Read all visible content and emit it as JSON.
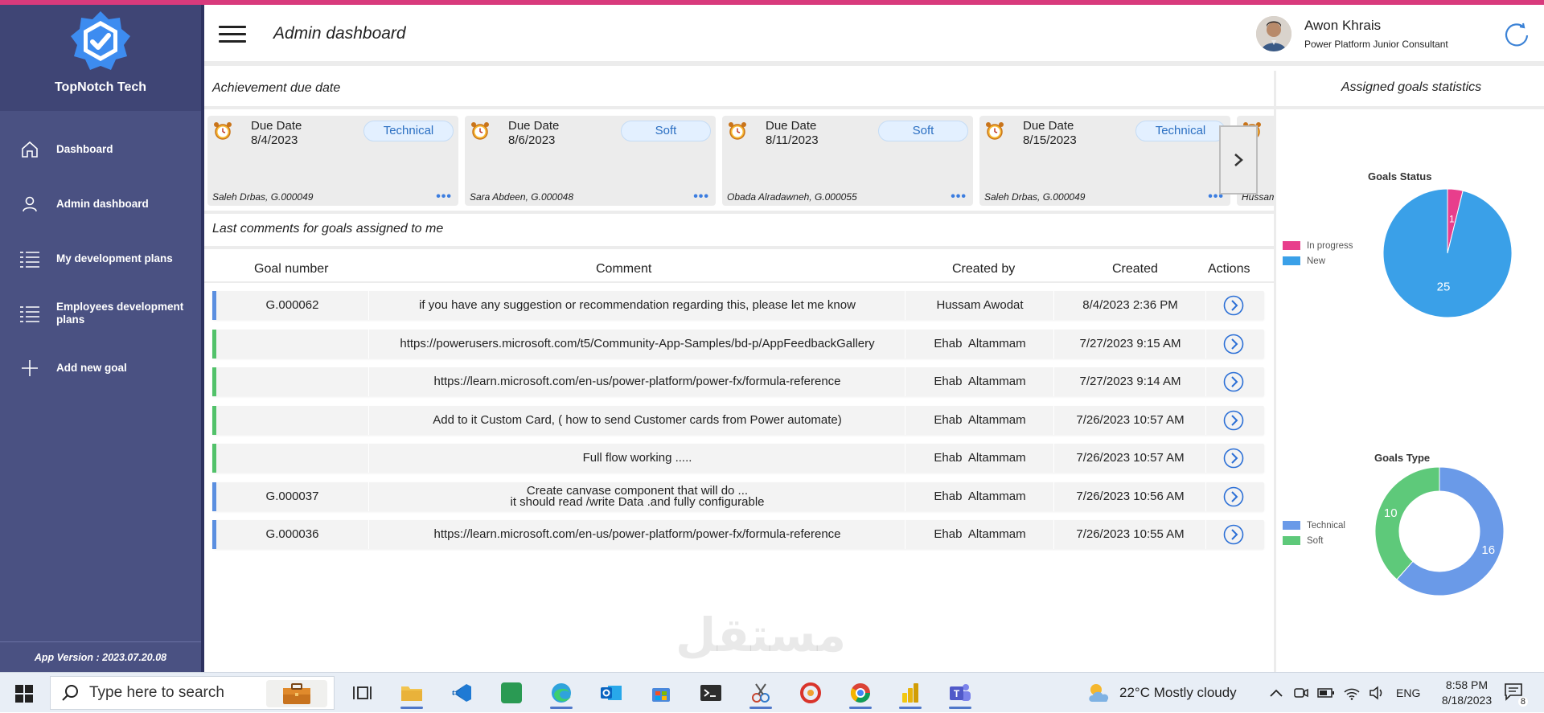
{
  "brand": {
    "name": "TopNotch Tech"
  },
  "sidebar": {
    "items": [
      {
        "label": "Dashboard",
        "icon": "home-icon"
      },
      {
        "label": "Admin dashboard",
        "icon": "person-icon"
      },
      {
        "label": "My development plans",
        "icon": "list-icon"
      },
      {
        "label": "Employees development plans",
        "icon": "list-icon"
      },
      {
        "label": "Add new goal",
        "icon": "plus-icon"
      }
    ],
    "version": "App Version : 2023.07.20.08"
  },
  "header": {
    "title": "Admin dashboard",
    "user_name": "Awon Khrais",
    "user_role": "Power Platform Junior Consultant"
  },
  "achievements": {
    "title": "Achievement due date",
    "cards": [
      {
        "due_label": "Due Date",
        "due_date": "8/4/2023",
        "type": "Technical",
        "who": "Saleh Drbas, G.000049"
      },
      {
        "due_label": "Due Date",
        "due_date": "8/6/2023",
        "type": "Soft",
        "who": "Sara Abdeen, G.000048"
      },
      {
        "due_label": "Due Date",
        "due_date": "8/11/2023",
        "type": "Soft",
        "who": "Obada Alradawneh, G.000055"
      },
      {
        "due_label": "Due Date",
        "due_date": "8/15/2023",
        "type": "Technical",
        "who": "Saleh Drbas, G.000049"
      },
      {
        "due_label": "",
        "due_date": "",
        "type": "",
        "who": "Hussam"
      }
    ]
  },
  "comments": {
    "title": "Last comments for goals assigned to me",
    "columns": {
      "goal": "Goal number",
      "comment": "Comment",
      "by": "Created by",
      "created": "Created",
      "actions": "Actions"
    },
    "rows": [
      {
        "goal": "G.000062",
        "comment": "if you have any suggestion or recommendation regarding this, please let me know",
        "by": "Hussam Awodat",
        "created": "8/4/2023 2:36 PM",
        "accent": "#5b8fe0"
      },
      {
        "goal": "",
        "comment": "https://powerusers.microsoft.com/t5/Community-App-Samples/bd-p/AppFeedbackGallery",
        "by": "Ehab  Altammam",
        "created": "7/27/2023 9:15 AM",
        "accent": "#52c26a"
      },
      {
        "goal": "",
        "comment": "https://learn.microsoft.com/en-us/power-platform/power-fx/formula-reference",
        "by": "Ehab  Altammam",
        "created": "7/27/2023 9:14 AM",
        "accent": "#52c26a"
      },
      {
        "goal": "",
        "comment": "Add to it Custom Card, ( how to send Customer cards from Power automate)",
        "by": "Ehab  Altammam",
        "created": "7/26/2023 10:57 AM",
        "accent": "#52c26a"
      },
      {
        "goal": "",
        "comment": "Full flow working .....",
        "by": "Ehab  Altammam",
        "created": "7/26/2023 10:57 AM",
        "accent": "#52c26a"
      },
      {
        "goal": "G.000037",
        "comment": "Create canvase component that will do ...\nit should read /write Data .and fully configurable",
        "by": "Ehab  Altammam",
        "created": "7/26/2023 10:56 AM",
        "accent": "#5b8fe0"
      },
      {
        "goal": "G.000036",
        "comment": "https://learn.microsoft.com/en-us/power-platform/power-fx/formula-reference",
        "by": "Ehab  Altammam",
        "created": "7/26/2023 10:55 AM",
        "accent": "#5b8fe0"
      }
    ]
  },
  "stats": {
    "title": "Assigned goals statistics"
  },
  "chart_data": [
    {
      "type": "pie",
      "title": "Goals Status",
      "categories": [
        "In progress",
        "New"
      ],
      "values": [
        1,
        25
      ],
      "colors": [
        "#e83e8c",
        "#3aa0e8"
      ],
      "legend": "left"
    },
    {
      "type": "pie",
      "title": "Goals Type",
      "categories": [
        "Technical",
        "Soft"
      ],
      "values": [
        16,
        10
      ],
      "colors": [
        "#6a9ae8",
        "#5ec97a"
      ],
      "donut": true,
      "legend": "left"
    }
  ],
  "taskbar": {
    "search_placeholder": "Type here to search",
    "weather": "22°C  Mostly cloudy",
    "language": "ENG",
    "time": "8:58 PM",
    "date": "8/18/2023",
    "notifications": "8"
  },
  "watermark": "مستقل"
}
